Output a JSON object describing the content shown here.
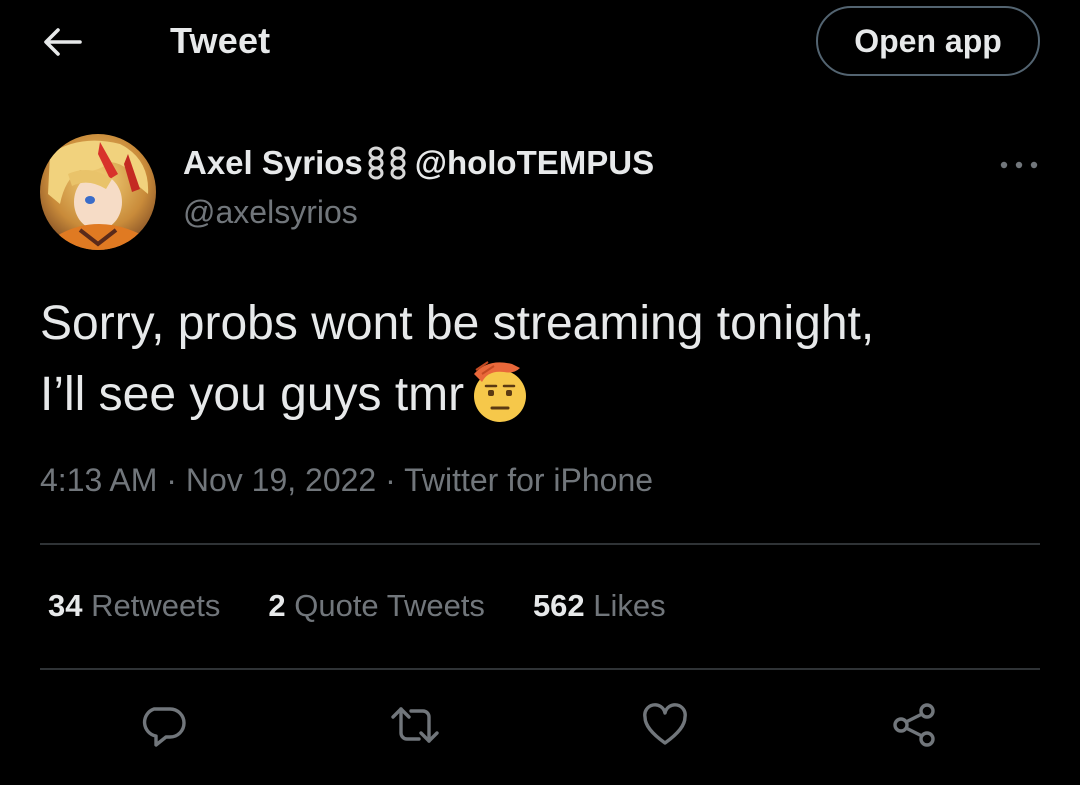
{
  "header": {
    "title": "Tweet",
    "back_icon": "back-arrow-icon",
    "open_app_label": "Open app"
  },
  "author": {
    "display_name": "Axel Syrios",
    "name_suffix": "@holoTEMPUS",
    "handle": "@axelsyrios",
    "name_icon": "chain-icon",
    "more_icon": "more-dots-icon"
  },
  "tweet": {
    "line1": "Sorry, probs wont be streaming tonight,",
    "line2": "I’ll see you guys tmr",
    "emoji": "saluting-face-emoji"
  },
  "meta": {
    "time": "4:13 AM",
    "sep1": "·",
    "date": "Nov 19, 2022",
    "sep2": "·",
    "source": "Twitter for iPhone"
  },
  "stats": {
    "retweets_count": "34",
    "retweets_label": "Retweets",
    "quotes_count": "2",
    "quotes_label": "Quote Tweets",
    "likes_count": "562",
    "likes_label": "Likes"
  },
  "actions": [
    "reply-icon",
    "retweet-icon",
    "like-icon",
    "share-icon"
  ],
  "colors": {
    "background": "#000000",
    "text": "#e7e9ea",
    "muted": "#71767b",
    "divider": "#2f3336",
    "button_border": "#536471"
  }
}
